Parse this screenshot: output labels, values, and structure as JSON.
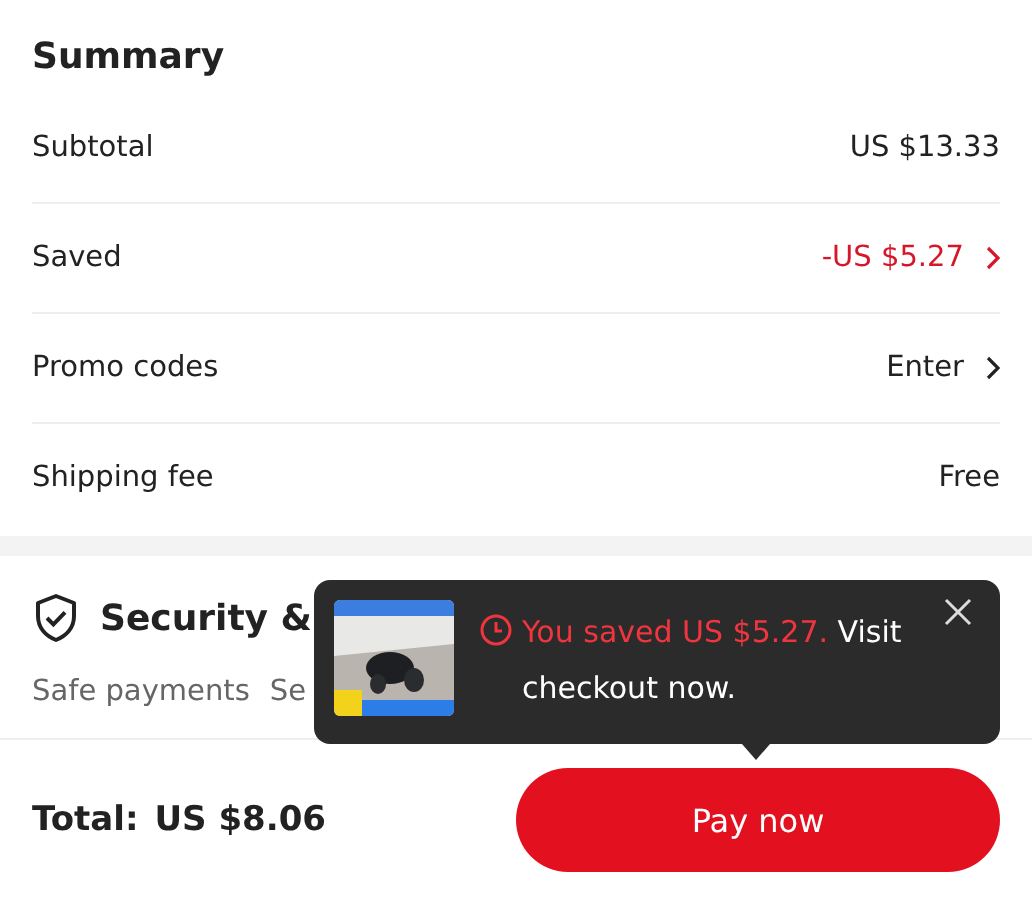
{
  "summary": {
    "title": "Summary",
    "rows": [
      {
        "kind": "plain",
        "label": "Subtotal",
        "value": "US $13.33",
        "chevron": false
      },
      {
        "kind": "discount",
        "label": "Saved",
        "value": "-US $5.27",
        "chevron": true
      },
      {
        "kind": "plain",
        "label": "Promo codes",
        "value": "Enter",
        "chevron": true
      },
      {
        "kind": "plain",
        "label": "Shipping fee",
        "value": "Free",
        "chevron": false
      }
    ]
  },
  "security": {
    "title": "Security &",
    "items": [
      "Safe payments",
      "Se"
    ]
  },
  "footer": {
    "total_label": "Total:",
    "total": "US $8.06",
    "button": "Pay now"
  },
  "toast": {
    "highlight": "You saved US $5.27.",
    "text": " Visit checkout now."
  }
}
